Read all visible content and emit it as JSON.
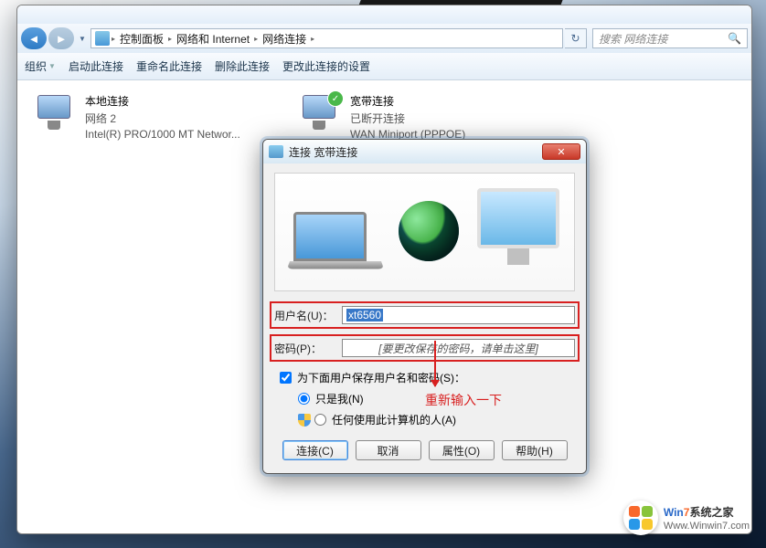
{
  "address_bar": {
    "crumbs": [
      "控制面板",
      "网络和 Internet",
      "网络连接"
    ],
    "search_placeholder": "搜索 网络连接"
  },
  "toolbar": {
    "organize": "组织",
    "items": [
      "启动此连接",
      "重命名此连接",
      "删除此连接",
      "更改此连接的设置"
    ]
  },
  "connections": {
    "local": {
      "name": "本地连接",
      "line2": "网络  2",
      "line3": "Intel(R) PRO/1000 MT Networ..."
    },
    "broadband": {
      "name": "宽带连接",
      "line2": "已断开连接",
      "line3": "WAN Miniport (PPPOE)"
    }
  },
  "dialog": {
    "title": "连接 宽带连接",
    "username_label": "用户名(U)：",
    "username_value": "xt6560",
    "password_label": "密码(P)：",
    "password_placeholder": "[要更改保存的密码，请单击这里]",
    "save_checkbox": "为下面用户保存用户名和密码(S)：",
    "radio_me": "只是我(N)",
    "radio_all": "任何使用此计算机的人(A)",
    "buttons": {
      "connect": "连接(C)",
      "cancel": "取消",
      "properties": "属性(O)",
      "help": "帮助(H)"
    }
  },
  "annotation": "重新输入一下",
  "watermark": {
    "brand_pre": "Win",
    "brand_num": "7",
    "brand_post": "系统之家",
    "url": "Www.Winwin7.com"
  }
}
